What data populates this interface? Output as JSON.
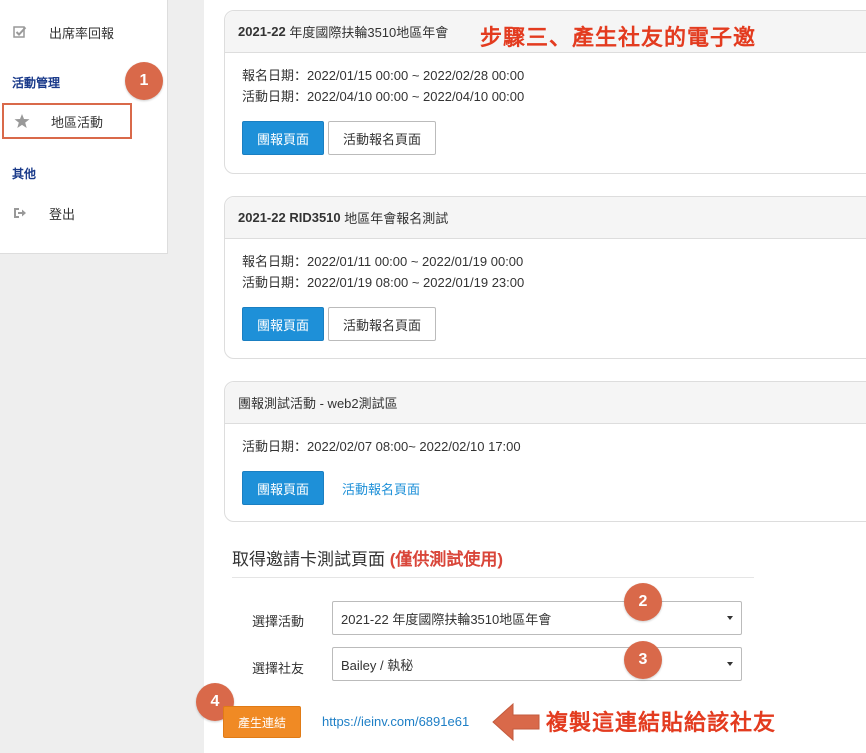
{
  "sidebar": {
    "items": [
      {
        "label": "出席率回報",
        "icon": "checkbox-icon"
      }
    ],
    "section_activity": "活動管理",
    "activity_item": {
      "label": "地區活動",
      "icon": "star-icon"
    },
    "section_other": "其他",
    "logout_item": {
      "label": "登出",
      "icon": "sign-out-icon"
    }
  },
  "annotations": {
    "step_title": "步驟三、產生社友的電子邀",
    "copy_hint": "複製這連結貼給該社友",
    "badge1": "1",
    "badge2": "2",
    "badge3": "3",
    "badge4": "4",
    "accent_color": "#e33b1f",
    "badge_color": "#d9694a"
  },
  "cards": [
    {
      "title_prefix": "2021-22 ",
      "title_rest": "年度國際扶輪3510地區年會",
      "reg_date": "報名日期：2022/01/15 00:00 ~ 2022/02/28 00:00",
      "event_date": "活動日期：2022/04/10 00:00 ~ 2022/04/10 00:00",
      "btn_primary": "團報頁面",
      "btn_secondary": "活動報名頁面"
    },
    {
      "title_prefix": "2021-22 RID3510 ",
      "title_rest": "地區年會報名測試",
      "reg_date": "報名日期：2022/01/11 00:00 ~ 2022/01/19 00:00",
      "event_date": "活動日期：2022/01/19 08:00 ~ 2022/01/19 23:00",
      "btn_primary": "團報頁面",
      "btn_secondary": "活動報名頁面"
    },
    {
      "title": "團報測試活動 - web2測試區",
      "event_date": "活動日期：2022/02/07 08:00~ 2022/02/10 17:00",
      "btn_primary": "團報頁面",
      "link_secondary": "活動報名頁面"
    }
  ],
  "invite_section": {
    "title": "取得邀請卡測試頁面",
    "title_note": "(僅供測試使用)",
    "activity_label": "選擇活動",
    "activity_value": "2021-22 年度國際扶輪3510地區年會",
    "member_label": "選擇社友",
    "member_value": "Bailey / 執秘",
    "generate_button": "產生連結",
    "generated_link": "https://ieinv.com/6891e61"
  }
}
